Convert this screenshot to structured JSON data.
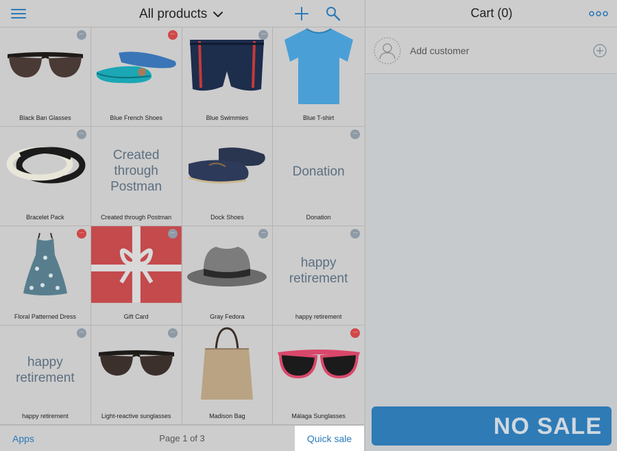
{
  "header": {
    "title": "All products"
  },
  "products": [
    {
      "name": "Black Ban Glasses",
      "badge": "",
      "text_image": ""
    },
    {
      "name": "Blue French Shoes",
      "badge": "red",
      "text_image": ""
    },
    {
      "name": "Blue Swimmies",
      "badge": "gray",
      "text_image": ""
    },
    {
      "name": "Blue T-shirt",
      "badge": "",
      "text_image": ""
    },
    {
      "name": "Bracelet Pack",
      "badge": "gray",
      "text_image": ""
    },
    {
      "name": "Created through Postman",
      "badge": "",
      "text_image": "Created through Postman"
    },
    {
      "name": "Dock Shoes",
      "badge": "",
      "text_image": ""
    },
    {
      "name": "Donation",
      "badge": "gray",
      "text_image": "Donation"
    },
    {
      "name": "Floral Patterned Dress",
      "badge": "red",
      "text_image": ""
    },
    {
      "name": "Gift Card",
      "badge": "gray",
      "text_image": ""
    },
    {
      "name": "Gray Fedora",
      "badge": "gray",
      "text_image": ""
    },
    {
      "name": "happy retirement",
      "badge": "gray",
      "text_image": "happy retirement"
    },
    {
      "name": "happy retirement",
      "badge": "gray",
      "text_image": "happy retirement"
    },
    {
      "name": "Light-reactive sunglasses",
      "badge": "gray",
      "text_image": ""
    },
    {
      "name": "Madison Bag",
      "badge": "",
      "text_image": ""
    },
    {
      "name": "Málaga Sunglasses",
      "badge": "red",
      "text_image": ""
    }
  ],
  "footer": {
    "apps": "Apps",
    "page": "Page 1 of 3",
    "quick_sale": "Quick sale"
  },
  "cart": {
    "title": "Cart (0)",
    "add_customer": "Add customer",
    "no_sale": "NO SALE"
  },
  "colors": {
    "accent": "#2b79b8",
    "badge_red": "#d04848",
    "badge_gray": "#8e9aa6",
    "no_sale_bg": "#2f7bb6"
  },
  "icons": {
    "menu": "hamburger-icon",
    "dropdown": "chevron-down-icon",
    "add": "plus-icon",
    "search": "search-icon",
    "more": "more-dots-icon",
    "customer": "user-avatar-icon",
    "add_customer": "plus-circle-icon",
    "tile_badge": "more-dots-icon"
  }
}
